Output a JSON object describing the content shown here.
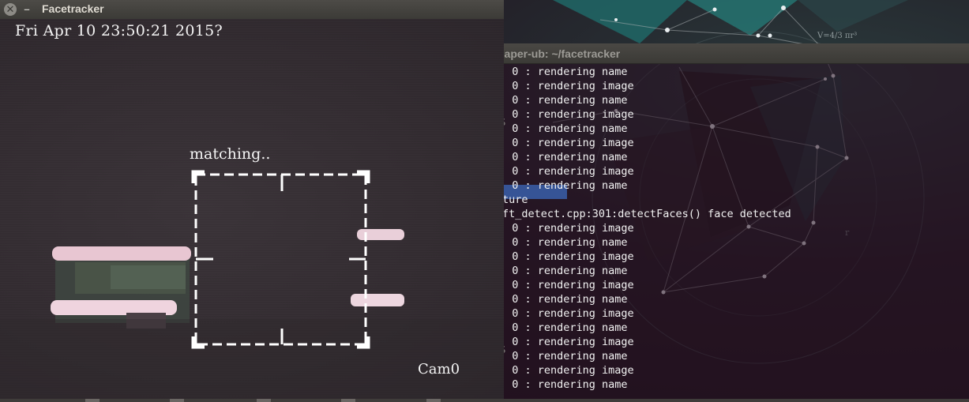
{
  "facetracker_window": {
    "title": "Facetracker",
    "close_icon": "close-icon",
    "minimize_icon": "minimize-icon",
    "timestamp": "Fri Apr 10 23:50:21 2015?",
    "status": "matching..",
    "camera": "Cam0"
  },
  "terminal_window": {
    "title": "naper-ub: ~/facetracker",
    "lines": [
      "0 : rendering name",
      "0 : rendering image",
      "0 : rendering name",
      "0 : rendering image",
      "0 : rendering name",
      "0 : rendering image",
      "0 : rendering name",
      "0 : rendering image",
      "0 : rendering name",
      "ture",
      "ft_detect.cpp:301:detectFaces() face detected",
      "0 : rendering image",
      "0 : rendering name",
      "0 : rendering image",
      "0 : rendering name",
      "0 : rendering image",
      "0 : rendering name",
      "0 : rendering image",
      "0 : rendering name",
      "0 : rendering image",
      "0 : rendering name",
      "0 : rendering image",
      "0 : rendering name"
    ]
  },
  "desktop": {
    "wallpaper_formula": "V=4/3 πr³",
    "wallpaper_label": "r"
  }
}
